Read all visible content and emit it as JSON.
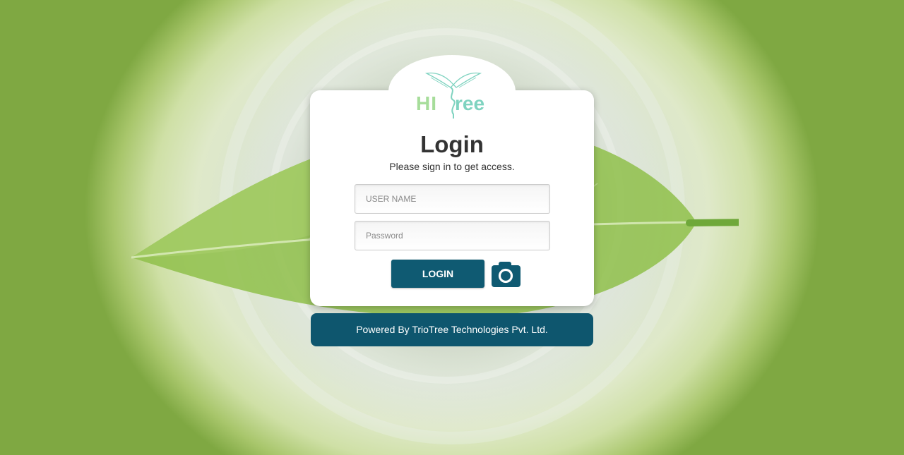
{
  "brand": {
    "logo_text": "HITree",
    "accent_color": "#7fd3c0",
    "primary_color": "#0f5a72"
  },
  "login": {
    "title": "Login",
    "subtitle": "Please sign in to get access.",
    "username_placeholder": "USER NAME",
    "username_value": "",
    "password_placeholder": "Password",
    "password_value": "",
    "login_button_label": "LOGIN",
    "camera_icon": "camera-icon"
  },
  "footer": {
    "text": "Powered By TrioTree Technologies Pvt. Ltd."
  }
}
